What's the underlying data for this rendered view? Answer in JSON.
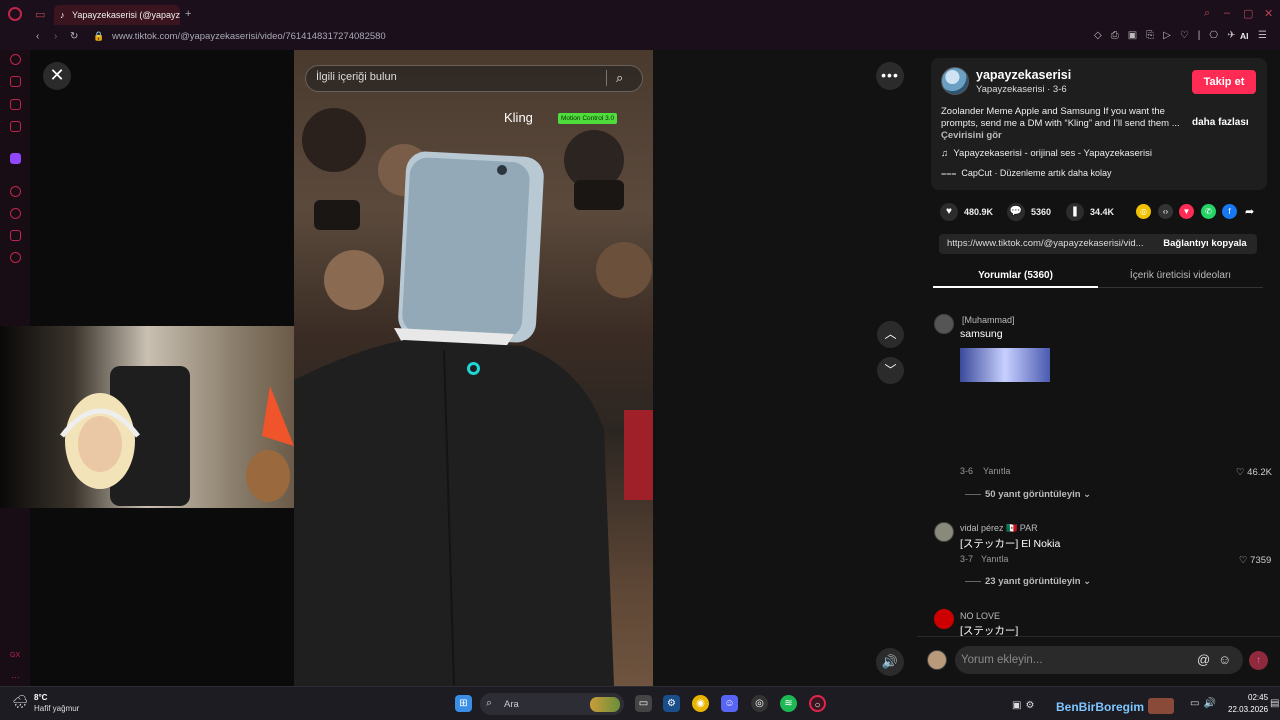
{
  "browser": {
    "tab_title": "Yapayzekaserisi (@yapayz",
    "url": "www.tiktok.com/@yapayzekaserisi/video/7614148317274082580"
  },
  "video": {
    "search_placeholder": "İlgili içeriği bulun",
    "watermark": "Kling",
    "watermark_badge": "Motion Control 3.0"
  },
  "info": {
    "author": "yapayzekaserisi",
    "author_sub": "Yapayzekaserisi · 3-6",
    "follow_label": "Takip et",
    "description": "Zoolander Meme Apple and Samsung If you want the prompts, send me a DM with “Kling” and I’ll send them ...",
    "more_label": "daha fazlası",
    "translate_label": "Çevirisini gör",
    "music": "Yapayzekaserisi - orijinal ses - Yapayzekaserisi",
    "capcut": "CapCut · Düzenleme artık daha kolay"
  },
  "stats": {
    "likes": "480.9K",
    "comments": "5360",
    "saves": "34.4K"
  },
  "share": {
    "link": "https://www.tiktok.com/@yapayzekaserisi/vid...",
    "copy_label": "Bağlantıyı kopyala"
  },
  "tabs": {
    "comments": "Yorumlar (5360)",
    "creator_videos": "İçerik üreticisi videoları"
  },
  "comments": [
    {
      "name": "[Muhammad]",
      "text": "samsung",
      "date": "3-6",
      "reply": "Yanıtla",
      "likes": "46.2K",
      "view_replies": "50 yanıt görüntüleyin"
    },
    {
      "name": "vidal pérez 🇲🇽 PAR",
      "text": "[ステッカー] El Nokia",
      "date": "3-7",
      "reply": "Yanıtla",
      "likes": "7359",
      "view_replies": "23 yanıt görüntüleyin"
    },
    {
      "name": "NO LOVE",
      "text": "[ステッカー]"
    }
  ],
  "comment_input_placeholder": "Yorum ekleyin...",
  "taskbar": {
    "temp": "8°C",
    "weather": "Hafif yağmur",
    "search": "Ara",
    "tray_label": "BenBirBoregim",
    "time": "02:45",
    "date": "22.03.2026"
  },
  "colors": {
    "accent": "#fe2c55",
    "opera_red": "#c0264a",
    "kling_badge": "#4fdd3c"
  }
}
